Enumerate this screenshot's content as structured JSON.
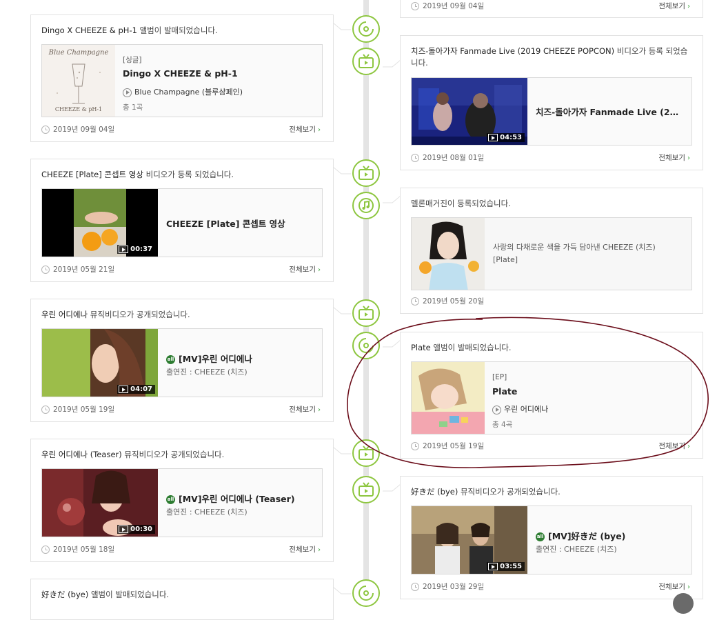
{
  "common": {
    "view_all": "전체보기",
    "chev": "›"
  },
  "colors": {
    "accent": "#8dc63f",
    "annotation": "#6b0d1a"
  },
  "cards": {
    "r0": {
      "date": "2019년 09월 04일"
    },
    "l1": {
      "pre": "Dingo X CHEEZE & pH-1 ",
      "post": "앨범이 발매되었습니다.",
      "type": "[싱글]",
      "album": "Dingo X CHEEZE & pH-1",
      "track": "Blue Champagne (블루샴페인)",
      "count": "총 1곡",
      "date": "2019년 09월 04일",
      "cover_text1": "Blue Champagne",
      "cover_text2": "CHEEZE & pH-1"
    },
    "r1": {
      "pre": "치즈-돌아가자 Fanmade Live (2019 CHEEZE POPCON) ",
      "post": "비디오가 등록 되었습니다.",
      "title": "치즈-돌아가자 Fanmade Live (2019 CHEEZE POPCON)",
      "duration": "04:53",
      "date": "2019년 08월 01일"
    },
    "l2": {
      "pre": "CHEEZE [Plate] 콘셉트 영상 ",
      "post": "비디오가 등록 되었습니다.",
      "title": "CHEEZE [Plate] 콘셉트 영상",
      "duration": "00:37",
      "date": "2019년 05월 21일"
    },
    "r2": {
      "post": "멜론매거진이 등록되었습니다.",
      "title": "사랑의 다채로운 색을 가득 담아낸 CHEEZE (치즈) [Plate]",
      "date": "2019년 05월 20일"
    },
    "l3": {
      "pre": "우린 어디에나 ",
      "post": "뮤직비디오가 공개되었습니다.",
      "badge": "all",
      "title": "[MV]우린 어디에나",
      "cast": "출연진 : CHEEZE (치즈)",
      "duration": "04:07",
      "date": "2019년 05월 19일"
    },
    "r3": {
      "pre": "Plate ",
      "post": "앨범이 발매되었습니다.",
      "type": "[EP]",
      "album": "Plate",
      "track": "우린 어디에나",
      "count": "총 4곡",
      "date": "2019년 05월 19일"
    },
    "l4": {
      "pre": "우린 어디에나 (Teaser) ",
      "post": "뮤직비디오가 공개되었습니다.",
      "badge": "all",
      "title": "[MV]우린 어디에나 (Teaser)",
      "cast": "출연진 : CHEEZE (치즈)",
      "duration": "00:30",
      "date": "2019년 05월 18일"
    },
    "r4": {
      "pre": "好きだ (bye) ",
      "post": "뮤직비디오가 공개되었습니다.",
      "badge": "all",
      "title": "[MV]好きだ (bye)",
      "cast": "출연진 : CHEEZE (치즈)",
      "duration": "03:55",
      "date": "2019년 03월 29일"
    },
    "l5": {
      "pre": "好きだ (bye) ",
      "post": "앨범이 발매되었습니다."
    }
  }
}
